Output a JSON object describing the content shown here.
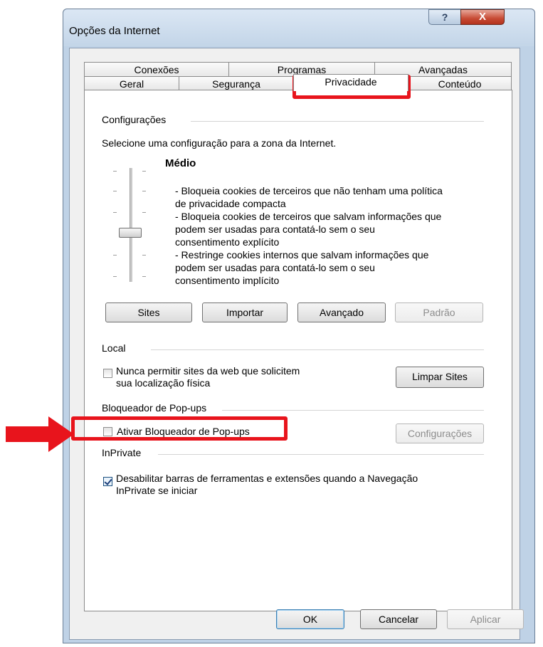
{
  "window": {
    "title": "Opções da Internet",
    "help_label": "?",
    "close_label": "X"
  },
  "tabs": {
    "row_back": [
      "Conexões",
      "Programas",
      "Avançadas"
    ],
    "row_front": [
      "Geral",
      "Segurança",
      "Privacidade",
      "Conteúdo"
    ],
    "active": "Privacidade"
  },
  "settings": {
    "section_label": "Configurações",
    "instruction": "Selecione uma configuração para a zona da Internet.",
    "level_title": "Médio",
    "slider_level_index": 3,
    "slider_level_count": 6,
    "description_lines": [
      "- Bloqueia cookies de terceiros que não tenham uma política",
      "de privacidade compacta",
      "- Bloqueia cookies de terceiros que salvam informações que",
      "podem ser usadas para contatá-lo sem o seu",
      "consentimento explícito",
      "- Restringe cookies internos que salvam informações que",
      "podem ser usadas para contatá-lo sem o seu",
      "consentimento implícito"
    ],
    "buttons": {
      "sites": "Sites",
      "import": "Importar",
      "advanced": "Avançado",
      "default": "Padrão"
    }
  },
  "local": {
    "section_label": "Local",
    "checkbox_label_line1": "Nunca permitir sites da web que solicitem",
    "checkbox_label_line2": "sua localização física",
    "checked": false,
    "clear_button": "Limpar Sites"
  },
  "popup": {
    "section_label": "Bloqueador de Pop-ups",
    "checkbox_label": "Ativar Bloqueador de Pop-ups",
    "checked": false,
    "settings_button": "Configurações"
  },
  "inprivate": {
    "section_label": "InPrivate",
    "checkbox_label_line1": "Desabilitar barras de ferramentas e extensões quando a Navegação",
    "checkbox_label_line2": "InPrivate se iniciar",
    "checked": true
  },
  "footer": {
    "ok": "OK",
    "cancel": "Cancelar",
    "apply": "Aplicar"
  },
  "annotations": {
    "color": "#e8141c"
  }
}
